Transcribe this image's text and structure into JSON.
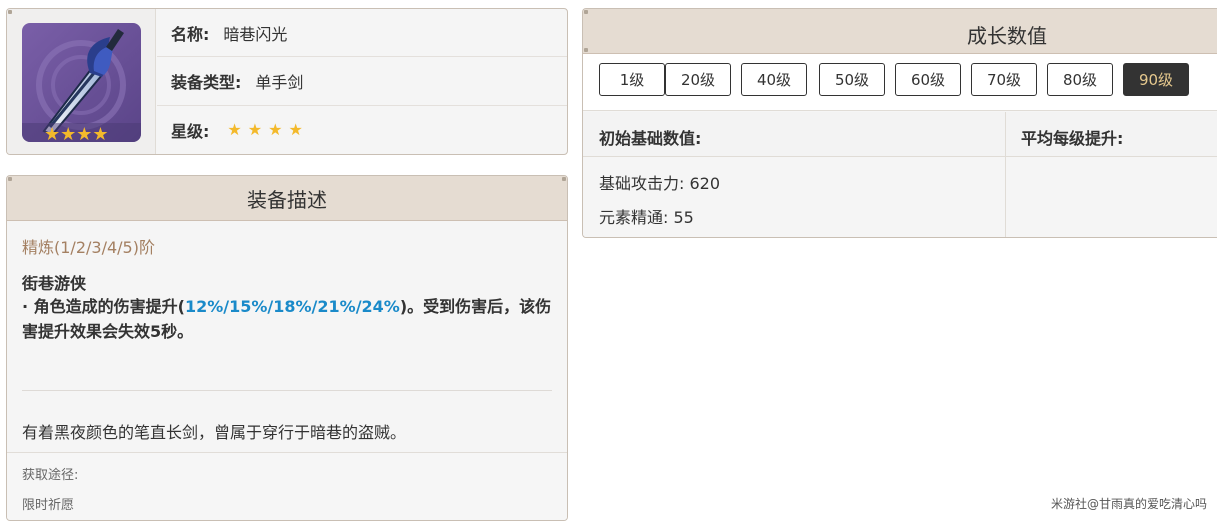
{
  "info": {
    "name_label": "名称:",
    "name_value": "暗巷闪光",
    "type_label": "装备类型:",
    "type_value": "单手剑",
    "rarity_label": "星级:",
    "rarity_stars": 4
  },
  "description": {
    "title": "装备描述",
    "refine": "精炼(1/2/3/4/5)阶",
    "skill_name": "街巷游侠",
    "skill_text_before": "· 角色造成的伤害提升(",
    "skill_text_highlight": "12%/15%/18%/21%/24%",
    "skill_text_after": ")。受到伤害后，该伤害提升效果会失效5秒。",
    "lore": "有着黑夜颜色的笔直长剑，曾属于穿行于暗巷的盗贼。",
    "source_label": "获取途径:",
    "source_value": "限时祈愿"
  },
  "growth": {
    "title": "成长数值",
    "levels": [
      "1级",
      "20级",
      "40级",
      "50级",
      "60级",
      "70级",
      "80级",
      "90级"
    ],
    "active_level": "90级",
    "initial_header": "初始基础数值:",
    "per_level_header": "平均每级提升:",
    "stat_atk": "基础攻击力: 620",
    "stat_em": "元素精通: 55"
  },
  "watermark": "米游社@甘雨真的爱吃清心吗",
  "colors": {
    "header_bg": "#e5dcd2",
    "highlight": "#1a8ac9",
    "refine_text": "#a48062",
    "star": "#f3b92b",
    "active_btn_bg": "#333333",
    "active_btn_text": "#e6c98e"
  }
}
